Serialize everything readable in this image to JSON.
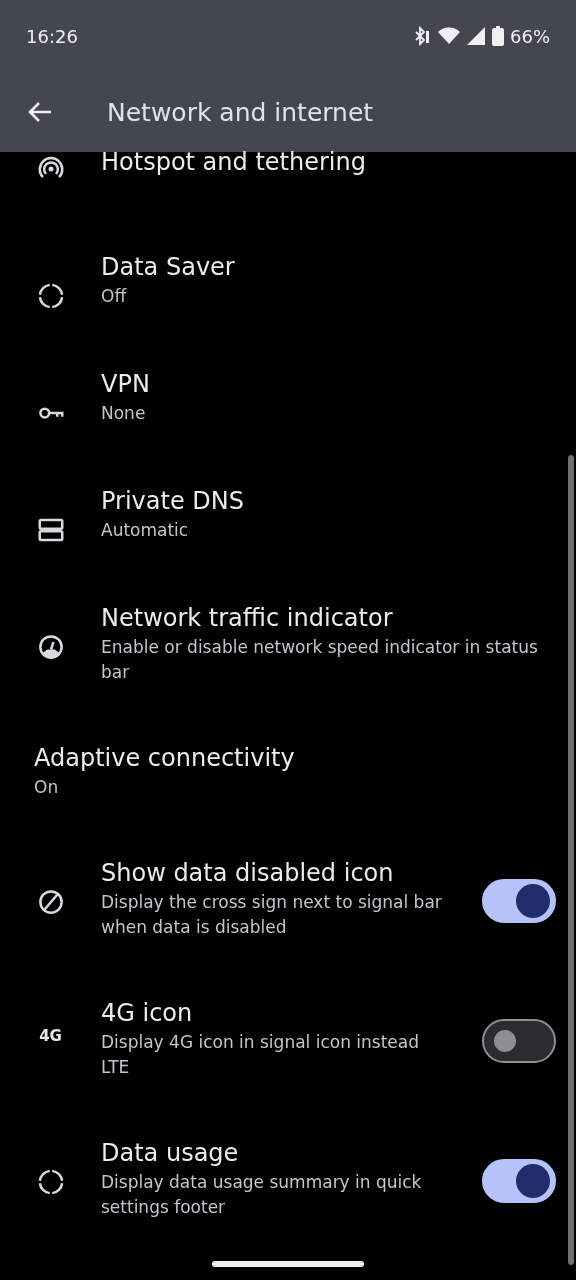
{
  "status_bar": {
    "time": "16:26",
    "battery": "66%"
  },
  "toolbar": {
    "title": "Network and internet"
  },
  "items": [
    {
      "kind": "hotspot",
      "title": "Hotspot and tethering"
    },
    {
      "kind": "datasaver",
      "title": "Data Saver",
      "subtitle": "Off"
    },
    {
      "kind": "vpn",
      "title": "VPN",
      "subtitle": "None"
    },
    {
      "kind": "dns",
      "title": "Private DNS",
      "subtitle": "Automatic"
    },
    {
      "kind": "gauge",
      "title": "Network traffic indicator",
      "subtitle": "Enable or disable network speed indicator in status bar"
    },
    {
      "kind": "plain",
      "title": "Adaptive connectivity",
      "subtitle": "On"
    },
    {
      "kind": "nodata",
      "title": "Show data disabled icon",
      "subtitle": "Display the cross sign next to signal bar when data is disabled",
      "on": true
    },
    {
      "kind": "fourg",
      "title": "4G icon",
      "subtitle": "Display 4G icon in signal icon instead LTE",
      "on": false,
      "icon_text": "4G"
    },
    {
      "kind": "datasaver",
      "title": "Data usage",
      "subtitle": "Display data usage summary in quick settings footer",
      "on": true
    }
  ]
}
